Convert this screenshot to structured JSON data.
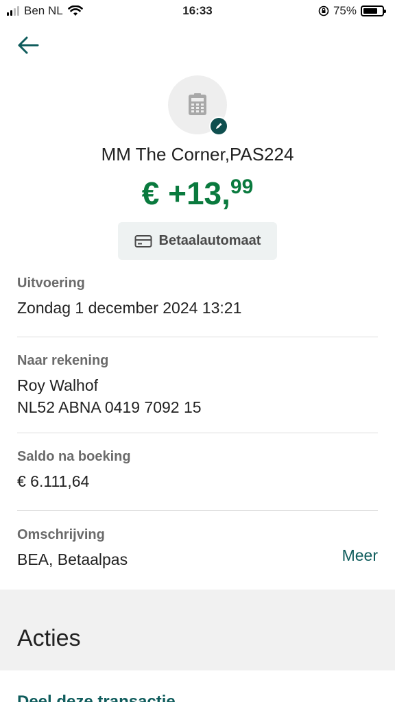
{
  "status_bar": {
    "carrier": "Ben NL",
    "time": "16:33",
    "battery_percent": "75%",
    "battery_level": 0.75
  },
  "header": {
    "merchant_name": "MM The Corner,PAS224",
    "amount_main": "€ +13,",
    "amount_cents": "99",
    "type_label": "Betaalautomaat",
    "amount_color": "#0a7a3e"
  },
  "details": {
    "execution": {
      "label": "Uitvoering",
      "value": "Zondag 1 december 2024 13:21"
    },
    "to_account": {
      "label": "Naar rekening",
      "name": "Roy Walhof",
      "iban": "NL52 ABNA 0419 7092 15"
    },
    "balance": {
      "label": "Saldo na boeking",
      "value": "€ 6.111,64"
    },
    "description": {
      "label": "Omschrijving",
      "value": "BEA, Betaalpas",
      "more_link": "Meer"
    }
  },
  "actions": {
    "title": "Acties",
    "share_label": "Deel deze transactie"
  },
  "icons": {
    "back": "arrow-left-icon",
    "merchant": "calculator-icon",
    "edit": "pencil-icon",
    "card": "credit-card-icon"
  },
  "colors": {
    "accent": "#0f5c5c",
    "positive": "#0a7a3e"
  }
}
